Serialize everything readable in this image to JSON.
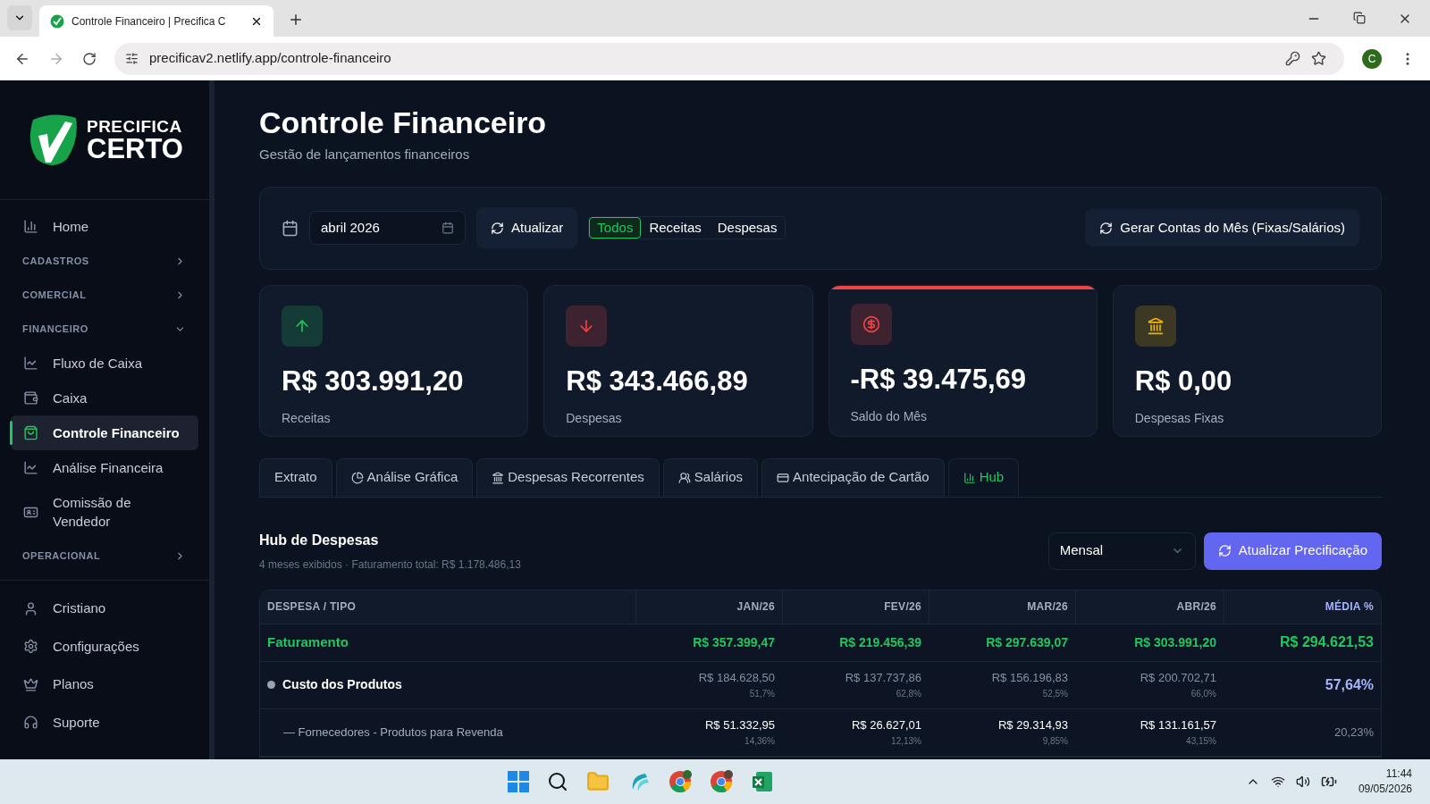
{
  "browser": {
    "tab_title": "Controle Financeiro | Precifica C",
    "url": "precificav2.netlify.app/controle-financeiro",
    "profile": "C"
  },
  "sidebar": {
    "logo_top": "PRECIFICA",
    "logo_bottom": "CERTO",
    "items": [
      {
        "kind": "link",
        "label": "Home",
        "selected": false
      },
      {
        "kind": "section",
        "label": "CADASTROS",
        "expanded": false
      },
      {
        "kind": "section",
        "label": "COMERCIAL",
        "expanded": false
      },
      {
        "kind": "section",
        "label": "FINANCEIRO",
        "expanded": true
      },
      {
        "kind": "link",
        "label": "Fluxo de Caixa",
        "selected": false
      },
      {
        "kind": "link",
        "label": "Caixa",
        "selected": false
      },
      {
        "kind": "link",
        "label": "Controle Financeiro",
        "selected": true
      },
      {
        "kind": "link",
        "label": "Análise Financeira",
        "selected": false
      },
      {
        "kind": "link",
        "label": "Comissão de Vendedor",
        "selected": false
      },
      {
        "kind": "section",
        "label": "OPERACIONAL",
        "expanded": false
      }
    ],
    "footer": [
      "Cristiano",
      "Configurações",
      "Planos",
      "Suporte"
    ]
  },
  "header": {
    "title": "Controle Financeiro",
    "subtitle": "Gestão de lançamentos financeiros"
  },
  "filters": {
    "month": "abril 2026",
    "refresh": "Atualizar",
    "types": [
      {
        "label": "Todos",
        "selected": true
      },
      {
        "label": "Receitas",
        "selected": false
      },
      {
        "label": "Despesas",
        "selected": false
      }
    ],
    "generate": "Gerar Contas do Mês (Fixas/Salários)"
  },
  "kpis": [
    {
      "value": "R$ 303.991,20",
      "label": "Receitas",
      "color": "#22c55e",
      "highlighted": false
    },
    {
      "value": "R$ 343.466,89",
      "label": "Despesas",
      "color": "#ef4444",
      "highlighted": false
    },
    {
      "value": "-R$ 39.475,69",
      "label": "Saldo do Mês",
      "color": "#ef4444",
      "highlighted": true
    },
    {
      "value": "R$ 0,00",
      "label": "Despesas Fixas",
      "color": "#eab308",
      "highlighted": false
    }
  ],
  "tabs": [
    {
      "label": "Extrato",
      "selected": false
    },
    {
      "label": "Análise Gráfica",
      "selected": false
    },
    {
      "label": "Despesas Recorrentes",
      "selected": false
    },
    {
      "label": "Salários",
      "selected": false
    },
    {
      "label": "Antecipação de Cartão",
      "selected": false
    },
    {
      "label": "Hub",
      "selected": true
    }
  ],
  "hub": {
    "title": "Hub de Despesas",
    "summary": "4 meses exibidos · Faturamento total: R$ 1.178.486,13",
    "period": "Mensal",
    "action": "Atualizar Precificação",
    "columns": [
      "DESPESA / TIPO",
      "JAN/26",
      "FEV/26",
      "MAR/26",
      "ABR/26",
      "MÉDIA %"
    ],
    "rows": [
      {
        "kind": "revenue",
        "cells": [
          {
            "value": "Faturamento"
          },
          {
            "value": "R$ 357.399,47"
          },
          {
            "value": "R$ 219.456,39"
          },
          {
            "value": "R$ 297.639,07"
          },
          {
            "value": "R$ 303.991,20"
          },
          {
            "value": "R$ 294.621,53"
          }
        ]
      },
      {
        "kind": "category",
        "color": "#9ca3af",
        "cells": [
          {
            "value": "Custo dos Produtos"
          },
          {
            "value": "R$ 184.628,50",
            "share": "51,7%"
          },
          {
            "value": "R$ 137.737,86",
            "share": "62,8%"
          },
          {
            "value": "R$ 156.196,83",
            "share": "52,5%"
          },
          {
            "value": "R$ 200.702,71",
            "share": "66,0%"
          },
          {
            "value": "57,64%"
          }
        ]
      },
      {
        "kind": "item",
        "cells": [
          {
            "value": "— Fornecedores - Produtos para Revenda"
          },
          {
            "value": "R$ 51.332,95",
            "share": "14,36%"
          },
          {
            "value": "R$ 26.627,01",
            "share": "12,13%"
          },
          {
            "value": "R$ 29.314,93",
            "share": "9,85%"
          },
          {
            "value": "R$ 131.161,57",
            "share": "43,15%"
          },
          {
            "value": "20,23%"
          }
        ]
      }
    ]
  },
  "taskbar": {
    "time": "11:44",
    "date": "09/05/2026"
  }
}
